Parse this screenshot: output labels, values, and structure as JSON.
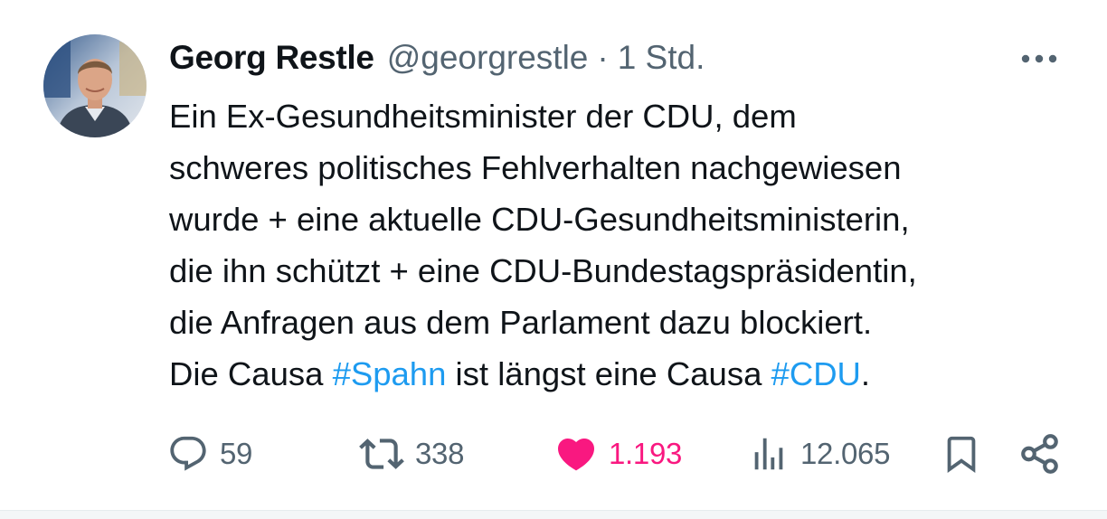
{
  "author": {
    "name": "Georg Restle",
    "handle": "@georgrestle",
    "separator": "·",
    "time": "1 Std."
  },
  "tweet": {
    "lines": [
      {
        "parts": [
          {
            "text": "Ein Ex-Gesundheitsminister der CDU, dem"
          }
        ]
      },
      {
        "parts": [
          {
            "text": "schweres politisches Fehlverhalten nachgewiesen"
          }
        ]
      },
      {
        "parts": [
          {
            "text": "wurde + eine aktuelle CDU-Gesundheitsministerin,"
          }
        ]
      },
      {
        "parts": [
          {
            "text": "die ihn schützt + eine CDU-Bundestagspräsidentin,"
          }
        ]
      },
      {
        "parts": [
          {
            "text": "die Anfragen aus dem Parlament dazu blockiert."
          }
        ]
      },
      {
        "parts": [
          {
            "text": "Die Causa "
          },
          {
            "text": "#Spahn",
            "hashtag": true
          },
          {
            "text": " ist längst eine Causa "
          },
          {
            "text": "#CDU",
            "hashtag": true
          },
          {
            "text": "."
          }
        ]
      }
    ]
  },
  "actions": {
    "reply": {
      "icon": "reply-icon",
      "count": "59"
    },
    "retweet": {
      "icon": "retweet-icon",
      "count": "338"
    },
    "like": {
      "icon": "heart-icon",
      "count": "1.193",
      "liked": true
    },
    "views": {
      "icon": "views-icon",
      "count": "12.065"
    },
    "bookmark": {
      "icon": "bookmark-icon"
    },
    "share": {
      "icon": "share-icon"
    }
  },
  "colors": {
    "text": "#0f1419",
    "secondary": "#536471",
    "hashtag": "#1d9bf0",
    "like": "#f91880"
  }
}
